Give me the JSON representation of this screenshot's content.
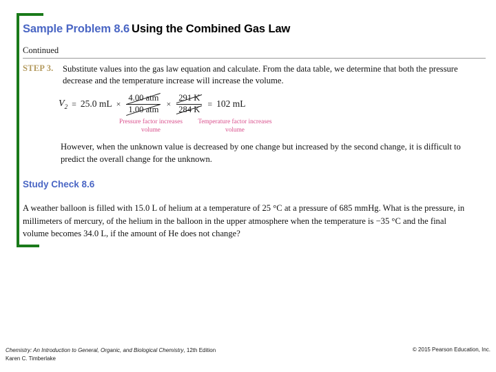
{
  "colors": {
    "accent_green": "#1a7a1a",
    "title_blue": "#4a66c4",
    "step_gold": "#b49a5e",
    "annotation_pink": "#d94f8c",
    "body_black": "#111111",
    "rule_gray": "#9a9a9a"
  },
  "header": {
    "title_accent": "Sample Problem 8.6",
    "title_rest": "Using the Combined Gas Law",
    "continued_label": "Continued"
  },
  "step": {
    "label": "STEP 3.",
    "text": "Substitute values into the gas law equation and calculate. From the data table, we determine that both the pressure decrease and the temperature increase will increase the volume."
  },
  "equation": {
    "variable": "V",
    "subscript": "2",
    "equals": "=",
    "initial_volume": "25.0 mL",
    "times_1": "×",
    "pressure_numerator": "4.00 atm",
    "pressure_denominator": "1.00 atm",
    "times_2": "×",
    "temperature_numerator": "291 K",
    "temperature_denominator": "284 K",
    "result_equals": "=",
    "result": "102 mL",
    "annotation_pressure": "Pressure factor increases volume",
    "annotation_temperature": "Temperature factor increases volume"
  },
  "however_text": "However, when the unknown value is decreased by one change but increased by the second change, it is difficult to predict the overall change for the unknown.",
  "study_check": {
    "heading": "Study Check 8.6",
    "body": "A weather balloon is filled with 15.0 L of helium at a temperature of 25 °C at a pressure of 685 mmHg. What is the pressure, in millimeters of mercury, of the helium in the balloon in the upper atmosphere when the temperature is −35 °C and the final volume becomes 34.0 L, if the amount of He does not change?"
  },
  "footer": {
    "book_title": "Chemistry: An Introduction to General, Organic, and Biological Chemistry",
    "edition": ", 12th Edition",
    "author": "Karen C. Timberlake",
    "copyright": "© 2015 Pearson Education, Inc."
  }
}
